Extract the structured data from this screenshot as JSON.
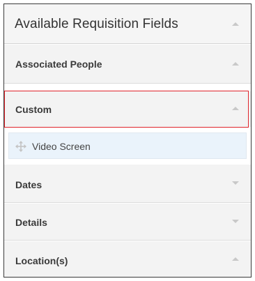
{
  "panel": {
    "title": "Available Requisition Fields"
  },
  "sections": {
    "associated_people": {
      "label": "Associated People",
      "state": "expanded"
    },
    "custom": {
      "label": "Custom",
      "state": "expanded",
      "highlighted": true
    },
    "dates": {
      "label": "Dates",
      "state": "collapsed"
    },
    "details": {
      "label": "Details",
      "state": "collapsed"
    },
    "locations": {
      "label": "Location(s)",
      "state": "expanded"
    }
  },
  "custom_fields": [
    {
      "label": "Video Screen",
      "icon": "move-icon"
    }
  ],
  "colors": {
    "highlight_border": "#e0242b",
    "field_item_bg": "#eaf3fb",
    "section_bg": "#f3f3f3"
  }
}
